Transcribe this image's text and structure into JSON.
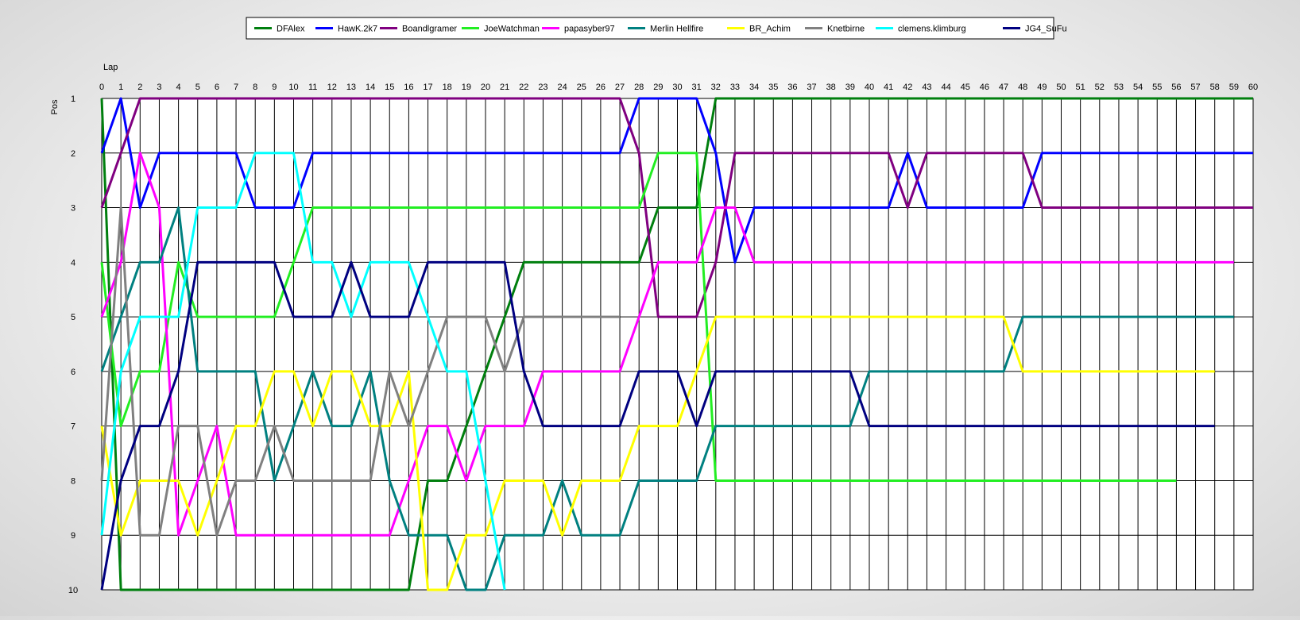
{
  "chart_data": {
    "type": "line",
    "xlabel": "Lap",
    "ylabel": "Pos",
    "x": [
      0,
      1,
      2,
      3,
      4,
      5,
      6,
      7,
      8,
      9,
      10,
      11,
      12,
      13,
      14,
      15,
      16,
      17,
      18,
      19,
      20,
      21,
      22,
      23,
      24,
      25,
      26,
      27,
      28,
      29,
      30,
      31,
      32,
      33,
      34,
      35,
      36,
      37,
      38,
      39,
      40,
      41,
      42,
      43,
      44,
      45,
      46,
      47,
      48,
      49,
      50,
      51,
      52,
      53,
      54,
      55,
      56,
      57,
      58,
      59,
      60
    ],
    "xlim": [
      0,
      60
    ],
    "ylim": [
      1,
      10
    ],
    "y_inverted": true,
    "y_ticks": [
      1,
      2,
      3,
      4,
      5,
      6,
      7,
      8,
      9,
      10
    ],
    "grid": true,
    "legend_position": "top-center",
    "series": [
      {
        "name": "DFAlex",
        "color": "#007f0e",
        "values": [
          1,
          10,
          10,
          10,
          10,
          10,
          10,
          10,
          10,
          10,
          10,
          10,
          10,
          10,
          10,
          10,
          10,
          8,
          8,
          7,
          6,
          5,
          4,
          4,
          4,
          4,
          4,
          4,
          4,
          3,
          3,
          3,
          1,
          1,
          1,
          1,
          1,
          1,
          1,
          1,
          1,
          1,
          1,
          1,
          1,
          1,
          1,
          1,
          1,
          1,
          1,
          1,
          1,
          1,
          1,
          1,
          1,
          1,
          1,
          1,
          1
        ]
      },
      {
        "name": "HawK.2k7",
        "color": "#0000ff",
        "values": [
          2,
          1,
          3,
          2,
          2,
          2,
          2,
          2,
          3,
          3,
          3,
          2,
          2,
          2,
          2,
          2,
          2,
          2,
          2,
          2,
          2,
          2,
          2,
          2,
          2,
          2,
          2,
          2,
          1,
          1,
          1,
          1,
          2,
          4,
          3,
          3,
          3,
          3,
          3,
          3,
          3,
          3,
          2,
          3,
          3,
          3,
          3,
          3,
          3,
          2,
          2,
          2,
          2,
          2,
          2,
          2,
          2,
          2,
          2,
          2,
          2
        ]
      },
      {
        "name": "Boandlgramer",
        "color": "#800080",
        "values": [
          3,
          2,
          1,
          1,
          1,
          1,
          1,
          1,
          1,
          1,
          1,
          1,
          1,
          1,
          1,
          1,
          1,
          1,
          1,
          1,
          1,
          1,
          1,
          1,
          1,
          1,
          1,
          1,
          2,
          5,
          5,
          5,
          4,
          2,
          2,
          2,
          2,
          2,
          2,
          2,
          2,
          2,
          3,
          2,
          2,
          2,
          2,
          2,
          2,
          3,
          3,
          3,
          3,
          3,
          3,
          3,
          3,
          3,
          3,
          3,
          3
        ]
      },
      {
        "name": "JoeWatchman",
        "color": "#22ee22",
        "values": [
          4,
          7,
          6,
          6,
          4,
          5,
          5,
          5,
          5,
          5,
          4,
          3,
          3,
          3,
          3,
          3,
          3,
          3,
          3,
          3,
          3,
          3,
          3,
          3,
          3,
          3,
          3,
          3,
          3,
          2,
          2,
          2,
          8,
          8,
          8,
          8,
          8,
          8,
          8,
          8,
          8,
          8,
          8,
          8,
          8,
          8,
          8,
          8,
          8,
          8,
          8,
          8,
          8,
          8,
          8,
          8,
          8
        ]
      },
      {
        "name": "papasyber97",
        "color": "#ff00ff",
        "values": [
          5,
          4,
          2,
          3,
          9,
          8,
          7,
          9,
          9,
          9,
          9,
          9,
          9,
          9,
          9,
          9,
          8,
          7,
          7,
          8,
          7,
          7,
          7,
          6,
          6,
          6,
          6,
          6,
          5,
          4,
          4,
          4,
          3,
          3,
          4,
          4,
          4,
          4,
          4,
          4,
          4,
          4,
          4,
          4,
          4,
          4,
          4,
          4,
          4,
          4,
          4,
          4,
          4,
          4,
          4,
          4,
          4,
          4,
          4,
          4
        ]
      },
      {
        "name": "Merlin Hellfire",
        "color": "#008080",
        "values": [
          6,
          5,
          4,
          4,
          3,
          6,
          6,
          6,
          6,
          8,
          7,
          6,
          7,
          7,
          6,
          8,
          9,
          9,
          9,
          10,
          10,
          9,
          9,
          9,
          8,
          9,
          9,
          9,
          8,
          8,
          8,
          8,
          7,
          7,
          7,
          7,
          7,
          7,
          7,
          7,
          6,
          6,
          6,
          6,
          6,
          6,
          6,
          6,
          5,
          5,
          5,
          5,
          5,
          5,
          5,
          5,
          5,
          5,
          5,
          5
        ]
      },
      {
        "name": "BR_Achim",
        "color": "#ffff00",
        "values": [
          7,
          9,
          8,
          8,
          8,
          9,
          8,
          7,
          7,
          6,
          6,
          7,
          6,
          6,
          7,
          7,
          6,
          10,
          10,
          9,
          9,
          8,
          8,
          8,
          9,
          8,
          8,
          8,
          7,
          7,
          7,
          6,
          5,
          5,
          5,
          5,
          5,
          5,
          5,
          5,
          5,
          5,
          5,
          5,
          5,
          5,
          5,
          5,
          6,
          6,
          6,
          6,
          6,
          6,
          6,
          6,
          6,
          6,
          6
        ]
      },
      {
        "name": "Knetbirne",
        "color": "#808080",
        "values": [
          8,
          3,
          9,
          9,
          7,
          7,
          9,
          8,
          8,
          7,
          8,
          8,
          8,
          8,
          8,
          6,
          7,
          6,
          5,
          5,
          5,
          6,
          5,
          5,
          5,
          5,
          5,
          5
        ]
      },
      {
        "name": "clemens.klimburg",
        "color": "#00ffff",
        "values": [
          9,
          6,
          5,
          5,
          5,
          3,
          3,
          3,
          2,
          2,
          2,
          4,
          4,
          5,
          4,
          4,
          4,
          5,
          6,
          6,
          8,
          10
        ]
      },
      {
        "name": "JG4_SuFu",
        "color": "#000080",
        "values": [
          10,
          8,
          7,
          7,
          6,
          4,
          4,
          4,
          4,
          4,
          5,
          5,
          5,
          4,
          5,
          5,
          5,
          4,
          4,
          4,
          4,
          4,
          6,
          7,
          7,
          7,
          7,
          7,
          6,
          6,
          6,
          7,
          6,
          6,
          6,
          6,
          6,
          6,
          6,
          6,
          7,
          7,
          7,
          7,
          7,
          7,
          7,
          7,
          7,
          7,
          7,
          7,
          7,
          7,
          7,
          7,
          7,
          7,
          7
        ]
      }
    ]
  }
}
